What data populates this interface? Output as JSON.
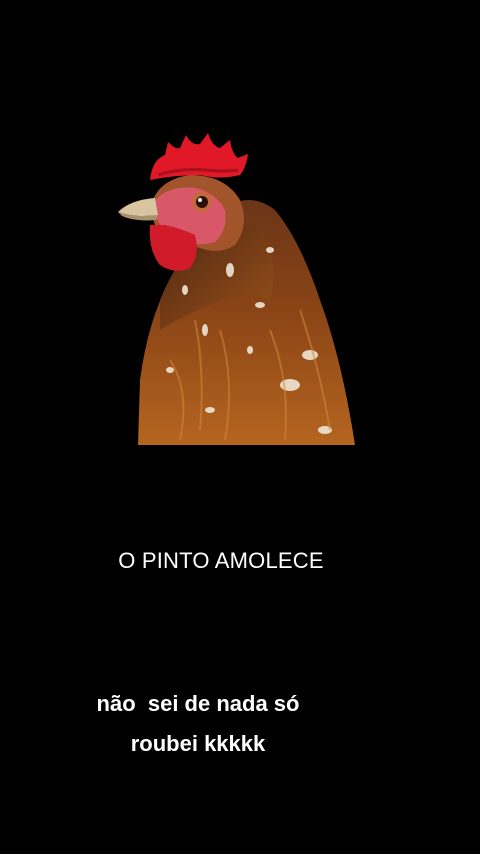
{
  "colors": {
    "background": "#000000",
    "text": "#ffffff",
    "comb": "#e01828",
    "feathers": "#8a3f14"
  },
  "image": {
    "subject_icon": "rooster-icon"
  },
  "captions": {
    "top": "O PINTO AMOLECE",
    "bottom_line1": "não  sei de nada só",
    "bottom_line2": "roubei kkkkk"
  }
}
